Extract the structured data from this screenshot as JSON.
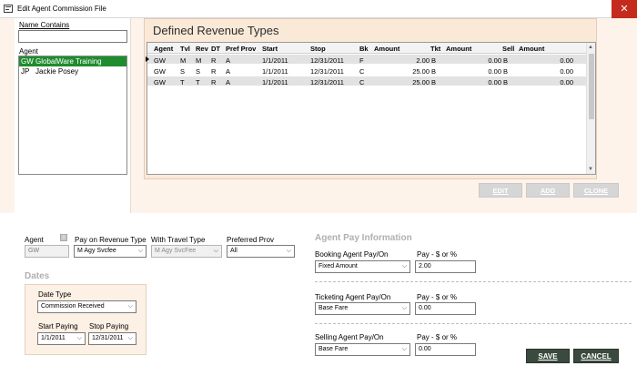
{
  "window": {
    "title": "Edit Agent Commission File",
    "close_glyph": "✕"
  },
  "left_panel": {
    "name_contains_label": "Name Contains",
    "name_contains_value": "",
    "agent_label": "Agent",
    "agents": [
      {
        "code": "GW",
        "name": "GlobalWare Training",
        "selected": true
      },
      {
        "code": "JP",
        "name": "Jackie Posey",
        "selected": false
      }
    ]
  },
  "revenue": {
    "title": "Defined Revenue Types",
    "columns": [
      "Agent",
      "Tvl",
      "Rev",
      "DT",
      "Pref Prov",
      "Start",
      "Stop",
      "Bk",
      "Amount",
      "Tkt",
      "Amount",
      "Sell",
      "Amount"
    ],
    "rows": [
      {
        "agent": "GW",
        "tvl": "M",
        "rev": "M",
        "dt": "R",
        "pref": "A",
        "start": "1/1/2011",
        "stop": "12/31/2011",
        "bk": "F",
        "amount1": "2.00",
        "tkt": "B",
        "amount2": "0.00",
        "sell": "B",
        "amount3": "0.00"
      },
      {
        "agent": "GW",
        "tvl": "S",
        "rev": "S",
        "dt": "R",
        "pref": "A",
        "start": "1/1/2011",
        "stop": "12/31/2011",
        "bk": "C",
        "amount1": "25.00",
        "tkt": "B",
        "amount2": "0.00",
        "sell": "B",
        "amount3": "0.00"
      },
      {
        "agent": "GW",
        "tvl": "T",
        "rev": "T",
        "dt": "R",
        "pref": "A",
        "start": "1/1/2011",
        "stop": "12/31/2011",
        "bk": "C",
        "amount1": "25.00",
        "tkt": "B",
        "amount2": "0.00",
        "sell": "B",
        "amount3": "0.00"
      }
    ],
    "buttons": {
      "edit": "EDIT",
      "add": "ADD",
      "clone": "CLONE"
    }
  },
  "form": {
    "agent_label": "Agent",
    "agent_value": "GW",
    "pay_on_revenue_label": "Pay on Revenue Type",
    "pay_on_revenue_value": "M Agy Svcfee",
    "with_travel_label": "With Travel Type",
    "with_travel_value": "M Agy SvcFee",
    "preferred_prov_label": "Preferred Prov",
    "preferred_prov_value": "All",
    "dates_title": "Dates",
    "date_type_label": "Date Type",
    "date_type_value": "Commission Received",
    "start_paying_label": "Start Paying",
    "start_paying_value": "1/1/2011",
    "stop_paying_label": "Stop Paying",
    "stop_paying_value": "12/31/2011"
  },
  "agent_pay": {
    "title": "Agent Pay Information",
    "booking_label": "Booking Agent Pay/On",
    "booking_value": "Fixed Amount",
    "booking_pay_label": "Pay - $ or %",
    "booking_pay_value": "2.00",
    "ticketing_label": "Ticketing Agent Pay/On",
    "ticketing_value": "Base Fare",
    "ticketing_pay_label": "Pay - $ or %",
    "ticketing_pay_value": "0.00",
    "selling_label": "Selling Agent Pay/On",
    "selling_value": "Base Fare",
    "selling_pay_label": "Pay - $ or %",
    "selling_pay_value": "0.00"
  },
  "footer": {
    "save": "SAVE",
    "cancel": "CANCEL"
  }
}
